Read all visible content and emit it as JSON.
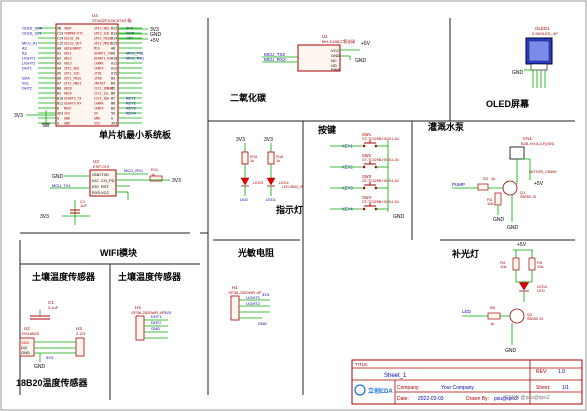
{
  "titles": {
    "mcu": "单片机最小系统板",
    "co2": "二氧化碳",
    "oled": "OLED屏幕",
    "keys": "按键",
    "pump": "灌溉水泵",
    "led_ind": "指示灯",
    "wifi": "WIFI模块",
    "soil1": "土壤温度传感器",
    "soil2": "土壤温度传感器",
    "photo": "光敏电阻",
    "fill": "补光灯",
    "ds18b20": "18B20温度传感器"
  },
  "u4": {
    "ref": "U4",
    "part": "STM32F103C8T6小板",
    "left_pins": [
      "VB",
      "C13",
      "C14",
      "C15",
      "A0",
      "A1",
      "A2",
      "A3",
      "A4",
      "A5",
      "A6",
      "A7",
      "B0",
      "B1",
      "B10",
      "B11",
      "R",
      "3V3",
      "G",
      "G"
    ],
    "left_nets": [
      "OLED_SDA",
      "OLED_SCL",
      "",
      "MCU_A1",
      "A2",
      "A3",
      "LIGHT1",
      "LIGHT2",
      "DHT1",
      "",
      "SDA",
      "SCL",
      "DHT2",
      "",
      "",
      "",
      "",
      "",
      "",
      ""
    ],
    "right_pins": [
      "B12",
      "B13",
      "B14",
      "B15",
      "A8",
      "A9",
      "A10",
      "A11",
      "A12",
      "A15",
      "B3",
      "B4",
      "B5",
      "B6",
      "B7",
      "B8",
      "B9",
      "5V",
      "G",
      "3V3"
    ],
    "right_nets": [
      "3V3",
      "GND",
      "+5V",
      "",
      "",
      "MCU_TX1",
      "MCU_RX1",
      "",
      "",
      "",
      "",
      "",
      "",
      "",
      "KEY1",
      "KEY2",
      "KEY3",
      "KEY4",
      "",
      ""
    ],
    "left_funcs": [
      "VBAT",
      "TAMPER-RTC",
      "OSC32_IN",
      "OSC32_OUT",
      "ADC0/WKUP",
      "ADC1",
      "ADC2",
      "ADC3",
      "SPI1_NSS",
      "SPI1_SCK",
      "SPI1_MISO",
      "SPI1_MOSI",
      "ADC8",
      "ADC9",
      "USART3_TX",
      "USART3_RX",
      "NRST",
      "3V3",
      "GND",
      "GND"
    ],
    "right_funcs": [
      "SPI2_NSS",
      "SPI2_SCK",
      "SPI2_MISO",
      "SPI2_MOSI",
      "MCO",
      "USART1_TX",
      "USART1_RX",
      "CANRX",
      "CANTX",
      "JTDI",
      "JTDO",
      "JNTRST",
      "I2C1_SMBAI",
      "I2C1_SCL",
      "I2C1_SDA",
      "CANRX",
      "CANTX",
      "5V",
      "GND",
      "3V3"
    ],
    "pwr": [
      "3V3",
      "GND",
      "+5V"
    ]
  },
  "u1": {
    "ref": "U1",
    "part": "MH-Z19B二氧化碳",
    "pins": [
      "VCC",
      "GND",
      "NC",
      "HD",
      "PWM"
    ],
    "nets": [
      "MCU_TX2",
      "MCU_RX2"
    ],
    "pwr": [
      "+5V",
      "GND"
    ]
  },
  "oled": {
    "ref": "OLED1",
    "part": "0.96OLED_4P",
    "pins": [
      "VCC",
      "GND",
      "SCL",
      "SDA"
    ],
    "gnd": "GND"
  },
  "keys": {
    "items": [
      {
        "ref": "SW1",
        "part": "GT-TC029B-H025-L1N",
        "net": "KEY1"
      },
      {
        "ref": "SW2",
        "part": "GT-TC029B-H025-L1N",
        "net": "KEY2"
      },
      {
        "ref": "SW3",
        "part": "GT-TC029B-H025-L1N",
        "net": "KEY3"
      },
      {
        "ref": "SW4",
        "part": "GT-TC029B-H025-L1N",
        "net": "KEY4"
      }
    ],
    "gnd": "GND"
  },
  "leds": {
    "pwr": [
      "3V3",
      "3V3"
    ],
    "r": [
      {
        "ref": "R15",
        "val": "1k"
      },
      {
        "ref": "R16",
        "val": "1k"
      }
    ],
    "d": [
      {
        "ref": "LED3",
        "part": "LED-0603_R"
      },
      {
        "ref": "LED1",
        "part": "LED-0603_R"
      }
    ],
    "nets": [
      "LED",
      "LED1"
    ]
  },
  "pump": {
    "cn": "CN1",
    "cn_part": "B2B-XH-A (LF)(SN)",
    "motor": "MOTOR_C8696",
    "r1": {
      "ref": "R2",
      "val": "1k"
    },
    "r2": {
      "ref": "R3",
      "val": "10k"
    },
    "q": {
      "ref": "Q1",
      "part": "S8050 J3"
    },
    "net": "PUMP",
    "pwr": [
      "+5V",
      "GND",
      "GND"
    ]
  },
  "wifi": {
    "ref": "U3",
    "part": "ESP-01S",
    "pins_l": [
      "GND",
      "IO2",
      "IO0",
      "RXD"
    ],
    "pins_r": [
      "TXD",
      "CH_PD",
      "RST",
      "VCC"
    ],
    "nets": [
      "MCU_RX1",
      "MCU_TX1",
      "R11",
      "1k",
      "C1",
      "1uF"
    ],
    "pwr": [
      "3V3",
      "GND",
      "3V3"
    ]
  },
  "soil": {
    "h4": {
      "ref": "H4",
      "part": "GP36-2520WR-4P"
    },
    "h1": {
      "ref": "H1",
      "part": "GP36-2520WR-4P"
    },
    "nets": [
      "3V3",
      "DHT1",
      "DHT2",
      "GND",
      "LIGHT1",
      "LIGHT2"
    ]
  },
  "fill": {
    "r": [
      {
        "ref": "R4",
        "val": "10k"
      },
      {
        "ref": "R5",
        "val": "10k"
      }
    ],
    "d": {
      "ref": "LED4",
      "part": "LED"
    },
    "q": {
      "ref": "Q2",
      "part": "S8050 J3"
    },
    "r3": {
      "ref": "R6",
      "val": "1k"
    },
    "net": "LED",
    "pwr": [
      "+5V",
      "GND"
    ]
  },
  "ds": {
    "c": {
      "ref": "C1",
      "val": "0.1uF"
    },
    "u": {
      "ref": "U2",
      "part": "DS18B20"
    },
    "h": {
      "ref": "H3",
      "part": "Z-2/3"
    },
    "pins": [
      "VDD",
      "DQ",
      "GND"
    ],
    "pwr": [
      "3V3",
      "GND"
    ]
  },
  "titleblock": {
    "title_label": "TITLE:",
    "title_value": "Sheet_1",
    "rev_label": "REV:",
    "rev_value": "1.0",
    "company_label": "Company:",
    "company_value": "Your Company",
    "sheet_label": "Sheet:",
    "sheet_value": "1/1",
    "date_label": "Date:",
    "date_value": "2022-03-03",
    "drawn_label": "Drawn By:",
    "drawn_value": "psu@qxo2",
    "logo_text": "立创EDA",
    "watermark": "CSDN @psu@qxo2"
  }
}
